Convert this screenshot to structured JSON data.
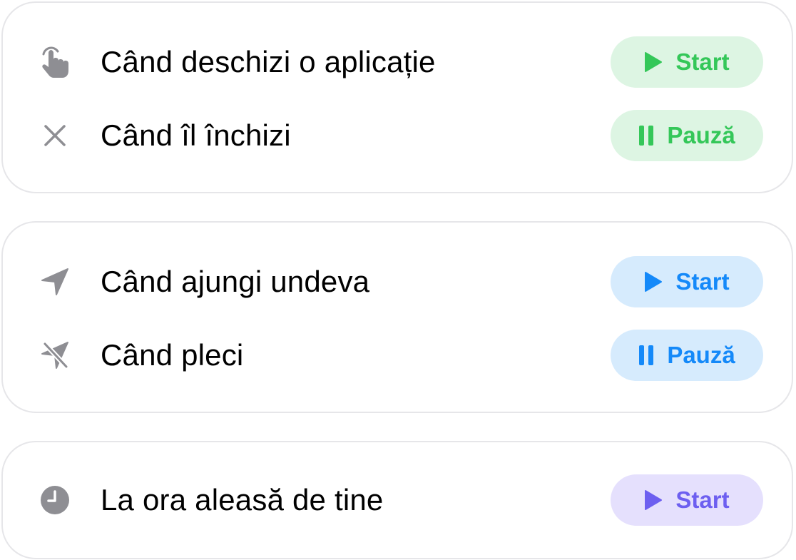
{
  "colors": {
    "green": "#34c759",
    "green_bg": "#ddf5e3",
    "blue": "#1489f9",
    "blue_bg": "#d6ebfd",
    "purple": "#6d5ff0",
    "purple_bg": "#e5e0fd",
    "icon_gray": "#8e8e93",
    "card_border": "#e6e6e9"
  },
  "groups": [
    {
      "items": [
        {
          "icon": "tap-hand-icon",
          "label": "Când deschizi o aplicație",
          "action": {
            "label": "Start",
            "icon": "play-icon",
            "color": "green"
          }
        },
        {
          "icon": "close-x-icon",
          "label": "Când îl închizi",
          "action": {
            "label": "Pauză",
            "icon": "pause-icon",
            "color": "green"
          }
        }
      ]
    },
    {
      "items": [
        {
          "icon": "location-arrow-icon",
          "label": "Când ajungi undeva",
          "action": {
            "label": "Start",
            "icon": "play-icon",
            "color": "blue"
          }
        },
        {
          "icon": "location-arrow-slash-icon",
          "label": "Când pleci",
          "action": {
            "label": "Pauză",
            "icon": "pause-icon",
            "color": "blue"
          }
        }
      ]
    },
    {
      "items": [
        {
          "icon": "clock-icon",
          "label": "La ora aleasă de tine",
          "action": {
            "label": "Start",
            "icon": "play-icon",
            "color": "purple"
          }
        }
      ]
    }
  ]
}
